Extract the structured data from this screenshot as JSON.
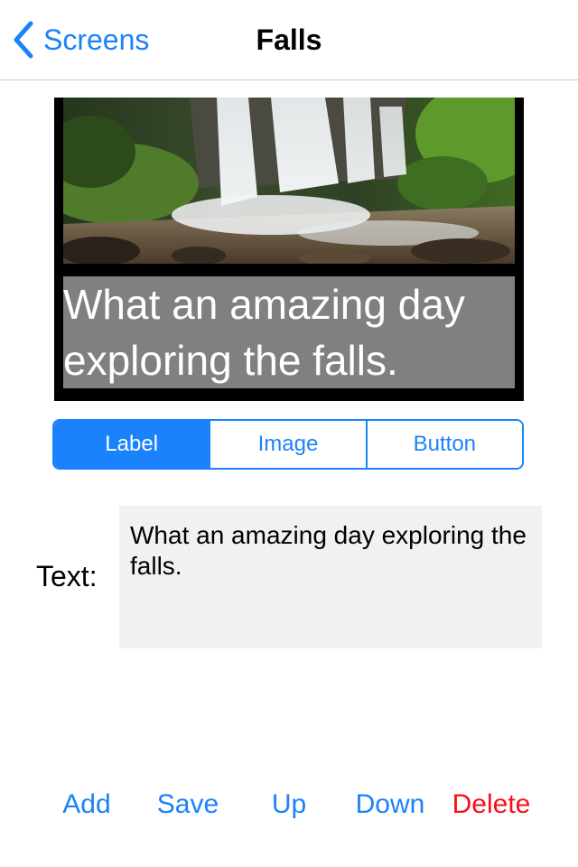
{
  "colors": {
    "accent": "#1a82fb",
    "danger": "#fc0d1b",
    "caption_bg": "#808080"
  },
  "navbar": {
    "back_icon": "chevron-left-icon",
    "back_label": "Screens",
    "title": "Falls"
  },
  "preview": {
    "image": "waterfall-photo",
    "caption": "What an amazing day exploring the falls."
  },
  "segmented": {
    "items": [
      {
        "label": "Label",
        "selected": true
      },
      {
        "label": "Image",
        "selected": false
      },
      {
        "label": "Button",
        "selected": false
      }
    ]
  },
  "form": {
    "text_label": "Text:",
    "text_value": "What an amazing day exploring the falls."
  },
  "bottom": {
    "add": "Add",
    "save": "Save",
    "up": "Up",
    "down": "Down",
    "delete": "Delete"
  }
}
